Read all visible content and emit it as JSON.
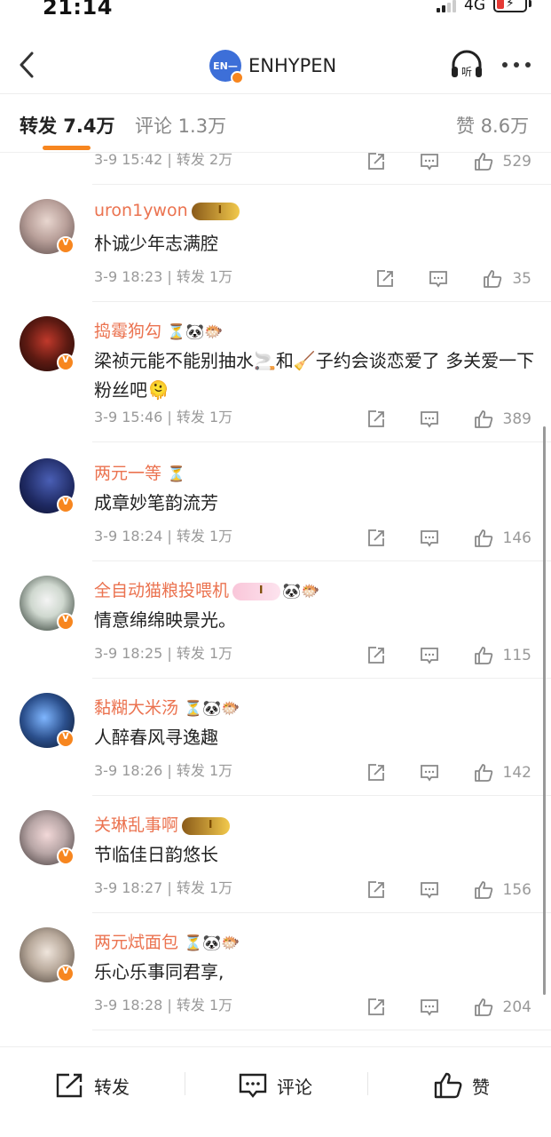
{
  "status_bar": {
    "time": "21:14",
    "network": "4G"
  },
  "header": {
    "title": "ENHYPEN",
    "avatar_text": "EN—"
  },
  "tabs": [
    {
      "label": "转发 7.4万"
    },
    {
      "label": "评论 1.3万"
    },
    {
      "label": "赞 8.6万"
    }
  ],
  "items": [
    {
      "meta": "3-9 15:42 | 转发 2万",
      "likes": "529"
    },
    {
      "username": "uron1ywon",
      "content": "朴诚少年志满腔",
      "meta": "3-9 18:23 | 转发 1万",
      "likes": "35",
      "emojis": ""
    },
    {
      "username": "捣霉狗勾",
      "content": "梁祯元能不能别抽水🚬和🧹子约会谈恋爱了 多关爱一下粉丝吧🫠",
      "meta": "3-9 15:46 | 转发 1万",
      "likes": "389",
      "emojis": "⏳🐼🐡"
    },
    {
      "username": "两元一等",
      "content": "成章妙笔韵流芳",
      "meta": "3-9 18:24 | 转发 1万",
      "likes": "146",
      "emojis": "⏳"
    },
    {
      "username": "全自动猫粮投喂机",
      "content": "情意绵绵映景光。",
      "meta": "3-9 18:25 | 转发 1万",
      "likes": "115",
      "emojis": "🐼🐡"
    },
    {
      "username": "黏糊大米汤",
      "content": "人醉春风寻逸趣",
      "meta": "3-9 18:26 | 转发 1万",
      "likes": "142",
      "emojis": "⏳🐼🐡"
    },
    {
      "username": "关琳乱事啊",
      "content": "节临佳日韵悠长",
      "meta": "3-9 18:27 | 转发 1万",
      "likes": "156",
      "emojis": ""
    },
    {
      "username": "两元烒面包",
      "content": "乐心乐事同君享,",
      "meta": "3-9 18:28 | 转发 1万",
      "likes": "204",
      "emojis": "⏳🐼🐡"
    }
  ],
  "bottom_bar": {
    "repost": "转发",
    "comment": "评论",
    "like": "赞"
  },
  "colors": {
    "accent": "#f7861f",
    "username": "#eb7350",
    "meta": "#999999"
  }
}
